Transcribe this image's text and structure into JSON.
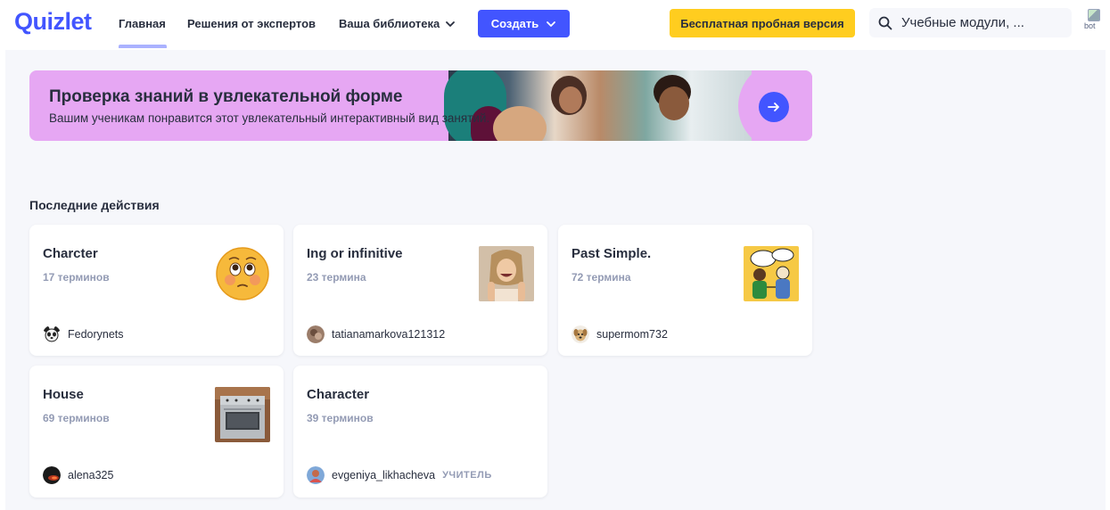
{
  "colors": {
    "brand": "#4255ff",
    "trial": "#ffcd1f",
    "banner_bg": "#e6a7f3",
    "muted_text": "#939bb4",
    "page_bg": "#f6f7fb"
  },
  "header": {
    "logo": "Quizlet",
    "nav": [
      {
        "label": "Главная",
        "icon": null
      },
      {
        "label": "Решения от экспертов",
        "icon": null
      },
      {
        "label": "Ваша библиотека",
        "icon": "chevron-down-icon"
      }
    ],
    "create_label": "Создать",
    "trial_label": "Бесплатная пробная версия",
    "search_placeholder": "Учебные модули, ...",
    "avatar_alt": "bot"
  },
  "banner": {
    "title": "Проверка знаний в увлекательной форме",
    "subtitle": "Вашим ученикам понравится этот увлекательный интерактивный вид занятий.",
    "action_icon": "arrow-right-icon"
  },
  "recent": {
    "title": "Последние действия",
    "cards": [
      {
        "title": "Charcter",
        "terms": "17 терминов",
        "user": "Fedorynets",
        "badge": "",
        "thumb": "emoji-face"
      },
      {
        "title": "Ing or infinitive",
        "terms": "23 термина",
        "user": "tatianamarkova121312",
        "badge": "",
        "thumb": "girl-photo"
      },
      {
        "title": "Past Simple.",
        "terms": "72 термина",
        "user": "supermom732",
        "badge": "",
        "thumb": "cartoon"
      },
      {
        "title": "House",
        "terms": "69 терминов",
        "user": "alena325",
        "badge": "",
        "thumb": "stove-photo"
      },
      {
        "title": "Character",
        "terms": "39 терминов",
        "user": "evgeniya_likhacheva",
        "badge": "УЧИТЕЛЬ",
        "thumb": null
      }
    ]
  }
}
